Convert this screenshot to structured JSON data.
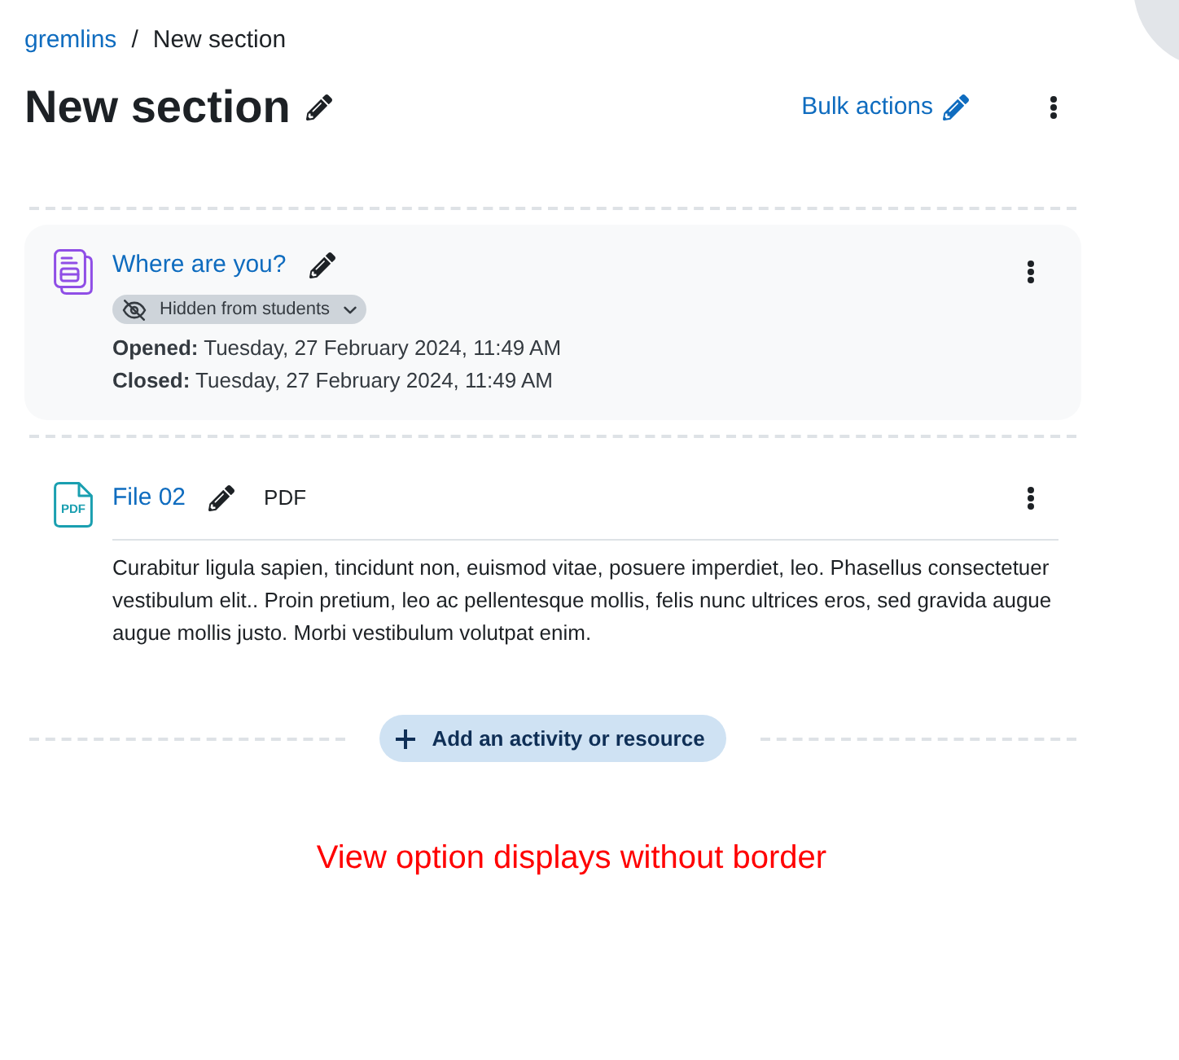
{
  "breadcrumb": {
    "items": [
      {
        "label": "gremlins",
        "kind": "link"
      },
      {
        "label": "New section",
        "kind": "current"
      }
    ],
    "separator": "/"
  },
  "header": {
    "title": "New section",
    "bulk_actions": "Bulk actions"
  },
  "activities": [
    {
      "kind": "assignment",
      "name": "Where are you?",
      "visibility_badge": "Hidden from students",
      "dates": [
        "**Opened:** Tuesday, 27 February 2024, 11:49 AM",
        "**Closed:** Tuesday, 27 February 2024, 11:49 AM"
      ]
    },
    {
      "kind": "file",
      "icon_label": "PDF",
      "name": "File 02",
      "type_label": "PDF",
      "description": "Curabitur ligula sapien, tincidunt non, euismod vitae, posuere imperdiet, leo. Phasellus consectetuer vestibulum elit.. Proin pretium, leo ac pellentesque mollis, felis nunc ultrices eros, sed gravida augue augue mollis justo. Morbi vestibulum volutpat enim."
    }
  ],
  "add_button": "Add an activity or resource",
  "annotation": "View option displays without border"
}
